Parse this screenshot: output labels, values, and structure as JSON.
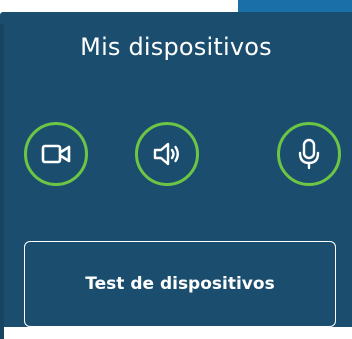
{
  "panel": {
    "title": "Mis dispositivos",
    "devices": [
      {
        "name": "camera",
        "icon": "video-camera-icon"
      },
      {
        "name": "speaker",
        "icon": "speaker-volume-icon"
      },
      {
        "name": "microphone",
        "icon": "microphone-icon"
      }
    ],
    "test_button_label": "Test de dispositivos"
  },
  "colors": {
    "panel_background": "#1b4e6e",
    "accent_tab": "#1b6fa8",
    "ring_green": "#6cc644",
    "foreground": "#ffffff"
  }
}
